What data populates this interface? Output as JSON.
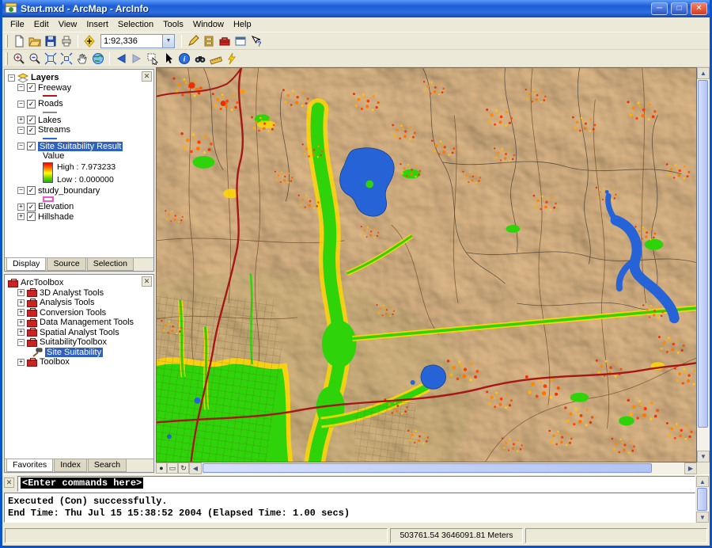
{
  "window": {
    "title": "Start.mxd - ArcMap - ArcInfo"
  },
  "menubar": {
    "items": [
      "File",
      "Edit",
      "View",
      "Insert",
      "Selection",
      "Tools",
      "Window",
      "Help"
    ]
  },
  "toolbar_standard": {
    "scale": "1:92,336",
    "buttons": [
      "new",
      "open",
      "save",
      "print",
      "add-data",
      "editor-pencil",
      "arccatalog",
      "arctoolbox",
      "command-line",
      "whats-this"
    ]
  },
  "toolbar_tools": {
    "buttons": [
      "zoom-in",
      "zoom-out",
      "fixed-zoom-in",
      "fixed-zoom-out",
      "pan",
      "full-extent",
      "go-back",
      "go-forward",
      "select-features",
      "select-elements",
      "identify",
      "find",
      "measure",
      "hyperlink"
    ]
  },
  "toc": {
    "root": "Layers",
    "tabs": [
      "Display",
      "Source",
      "Selection"
    ],
    "layers": [
      {
        "name": "Freeway"
      },
      {
        "name": "Roads"
      },
      {
        "name": "Lakes"
      },
      {
        "name": "Streams"
      },
      {
        "name": "Site Suitability Result",
        "legend": {
          "field": "Value",
          "high": "High : 7.973233",
          "low": "Low : 0.000000"
        }
      },
      {
        "name": "study_boundary"
      },
      {
        "name": "Elevation"
      },
      {
        "name": "Hillshade"
      }
    ]
  },
  "toolbox": {
    "root": "ArcToolbox",
    "tabs": [
      "Favorites",
      "Index",
      "Search"
    ],
    "items": [
      "3D Analyst Tools",
      "Analysis Tools",
      "Conversion Tools",
      "Data Management Tools",
      "Spatial Analyst Tools",
      "SuitabilityToolbox",
      "Site Suitability",
      "Toolbox"
    ]
  },
  "command_window": {
    "prompt": "<Enter commands here>",
    "lines": [
      "Executed (Con) successfully.",
      "End Time: Thu Jul 15 15:38:52 2004 (Elapsed Time: 1.00 secs)"
    ]
  },
  "statusbar": {
    "coordinates": "503761.54 3646091.81 Meters"
  }
}
